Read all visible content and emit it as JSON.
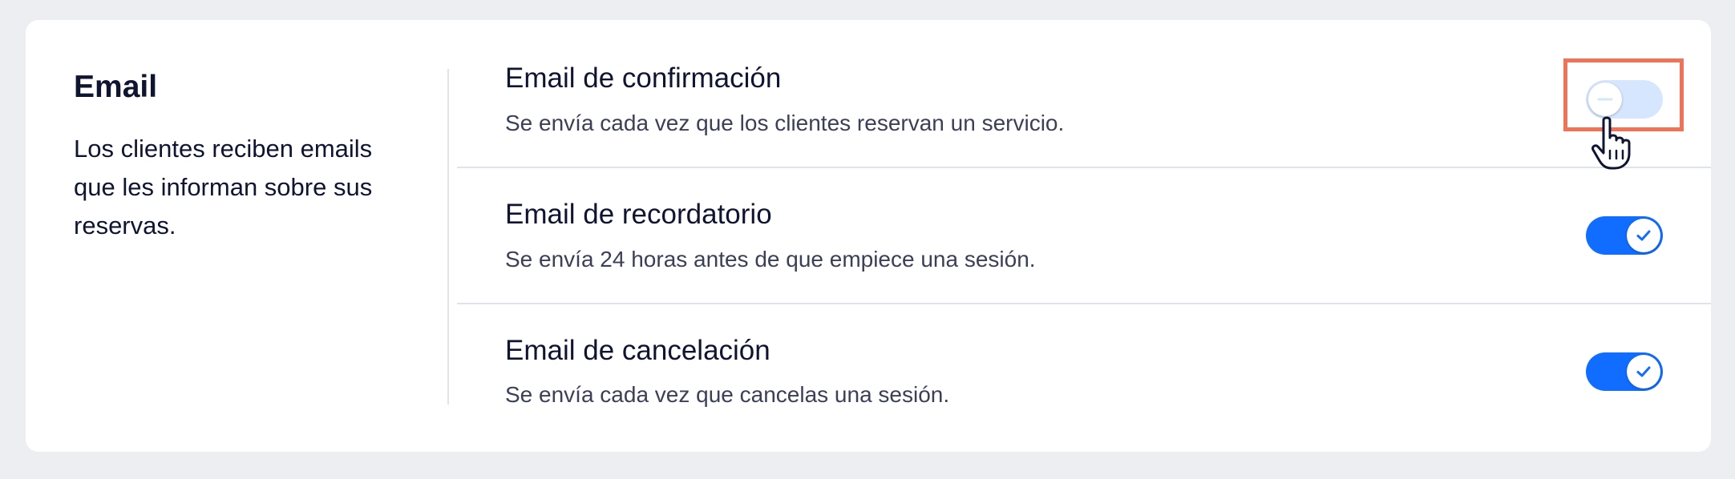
{
  "section": {
    "title": "Email",
    "description": "Los clientes reciben emails que les informan sobre sus reservas."
  },
  "emails": [
    {
      "title": "Email de confirmación",
      "description": "Se envía cada vez que los clientes reservan un servicio.",
      "enabled": false
    },
    {
      "title": "Email de recordatorio",
      "description": "Se envía 24 horas antes de que empiece una sesión.",
      "enabled": true
    },
    {
      "title": "Email de cancelación",
      "description": "Se envía cada vez que cancelas una sesión.",
      "enabled": true
    }
  ],
  "colors": {
    "accent": "#116dff",
    "toggle_off": "#d6e6fe",
    "highlight": "#f07357",
    "background": "#eceef2"
  },
  "icons": {
    "toggle_on": "check-icon",
    "toggle_off": "minus-icon",
    "cursor": "hand-pointer-icon"
  }
}
